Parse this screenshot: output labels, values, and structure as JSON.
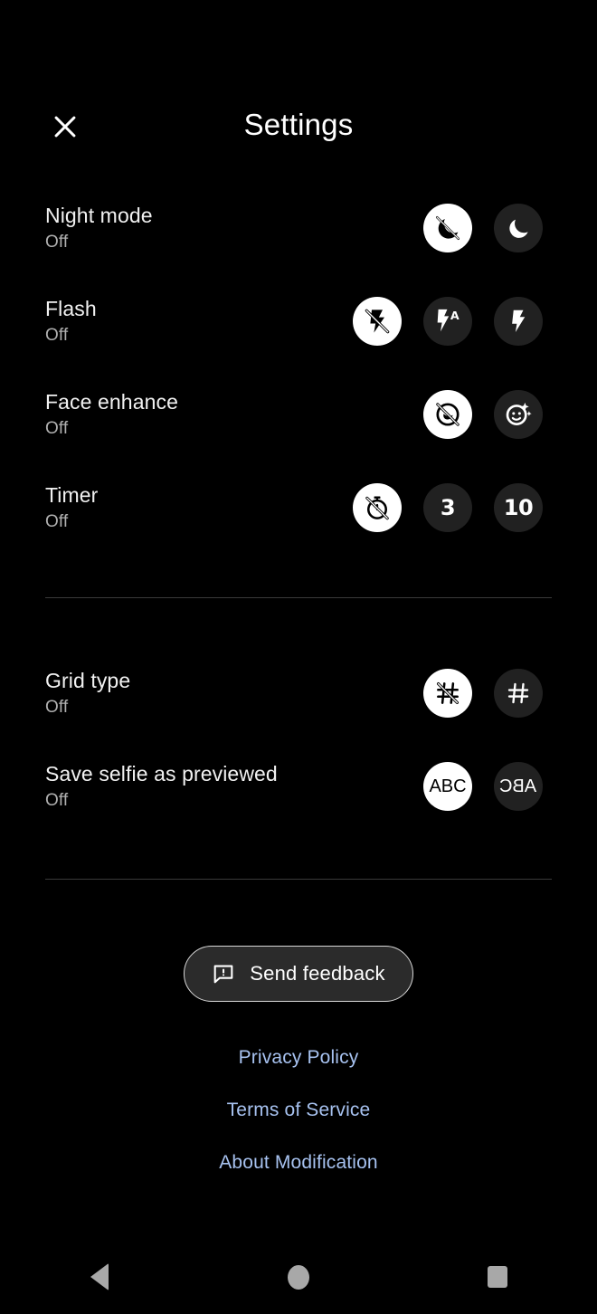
{
  "header": {
    "title": "Settings",
    "close_icon": "close-icon"
  },
  "sections": [
    {
      "id": "capture",
      "rows": [
        {
          "id": "night-mode",
          "label": "Night mode",
          "value": "Off",
          "options": [
            {
              "icon": "night-mode-off-icon",
              "selected": true
            },
            {
              "icon": "moon-icon",
              "selected": false
            }
          ]
        },
        {
          "id": "flash",
          "label": "Flash",
          "value": "Off",
          "options": [
            {
              "icon": "flash-off-icon",
              "selected": true
            },
            {
              "icon": "flash-auto-icon",
              "selected": false
            },
            {
              "icon": "flash-on-icon",
              "selected": false
            }
          ]
        },
        {
          "id": "face-enhance",
          "label": "Face enhance",
          "value": "Off",
          "options": [
            {
              "icon": "face-enhance-off-icon",
              "selected": true
            },
            {
              "icon": "face-enhance-on-icon",
              "selected": false
            }
          ]
        },
        {
          "id": "timer",
          "label": "Timer",
          "value": "Off",
          "options": [
            {
              "icon": "timer-off-icon",
              "selected": true
            },
            {
              "icon": "timer-3s-icon",
              "text": "3",
              "selected": false
            },
            {
              "icon": "timer-10s-icon",
              "text": "10",
              "selected": false
            }
          ]
        }
      ]
    },
    {
      "id": "composition",
      "rows": [
        {
          "id": "grid-type",
          "label": "Grid type",
          "value": "Off",
          "options": [
            {
              "icon": "grid-off-icon",
              "selected": true
            },
            {
              "icon": "grid-on-icon",
              "selected": false
            }
          ]
        },
        {
          "id": "save-selfie-as-previewed",
          "label": "Save selfie as previewed",
          "value": "Off",
          "options": [
            {
              "icon": "abc-normal-icon",
              "text": "ABC",
              "selected": true
            },
            {
              "icon": "abc-mirrored-icon",
              "text": "ABC",
              "selected": false
            }
          ]
        }
      ]
    }
  ],
  "feedback": {
    "label": "Send feedback",
    "icon": "feedback-bubble-icon"
  },
  "links": [
    {
      "id": "privacy-policy",
      "label": "Privacy Policy"
    },
    {
      "id": "terms-of-service",
      "label": "Terms of Service"
    },
    {
      "id": "about-modification",
      "label": "About Modification"
    }
  ],
  "navbar": {
    "back": "back-triangle-icon",
    "home": "home-circle-icon",
    "recents": "recents-square-icon"
  },
  "colors": {
    "background": "#000000",
    "selected_chip": "#ffffff",
    "unselected_chip": "#212121",
    "label": "#f1f1f1",
    "value": "#b0b0b0",
    "link": "#a7c2f0",
    "divider": "#3a3a3a",
    "navbar_icon": "#a8a8a8"
  }
}
